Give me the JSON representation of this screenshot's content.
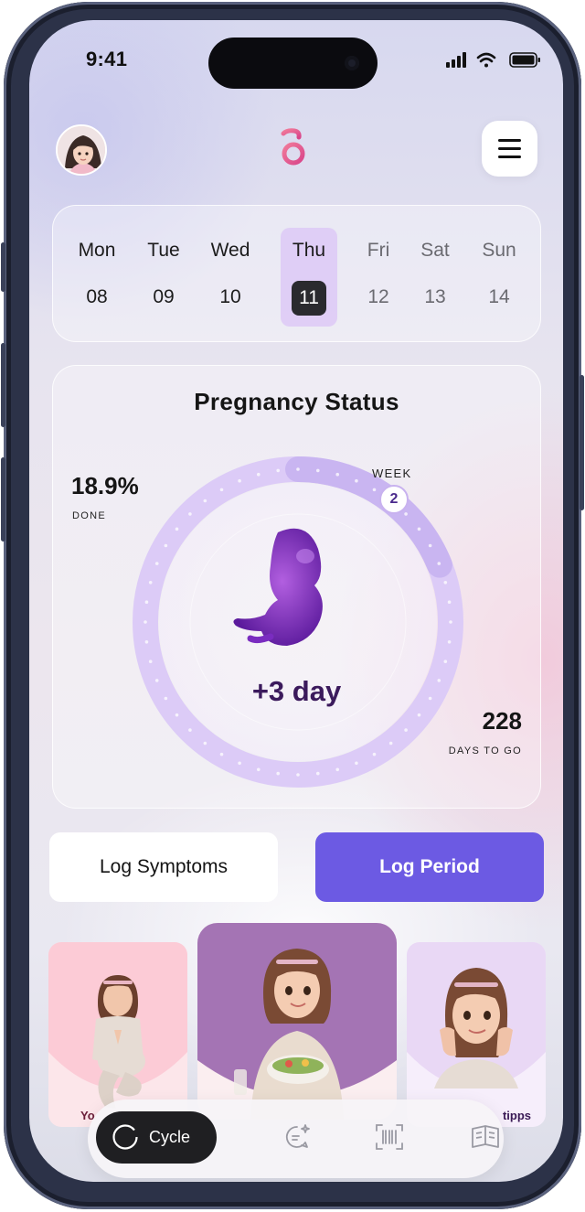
{
  "status_bar": {
    "time": "9:41"
  },
  "header": {
    "menu_icon": "hamburger-menu-icon",
    "brand_color": "#e15a8e"
  },
  "calendar": {
    "days": [
      {
        "name": "Mon",
        "num": "08"
      },
      {
        "name": "Tue",
        "num": "09"
      },
      {
        "name": "Wed",
        "num": "10"
      },
      {
        "name": "Thu",
        "num": "11"
      },
      {
        "name": "Fri",
        "num": "12"
      },
      {
        "name": "Sat",
        "num": "13"
      },
      {
        "name": "Sun",
        "num": "14"
      }
    ],
    "selected": "Thu"
  },
  "pregnancy": {
    "title": "Pregnancy Status",
    "percent_done": "18.9%",
    "done_label": "DONE",
    "week_label": "WEEK",
    "week_value": "2",
    "day_delta": "+3 day",
    "days_to_go": "228",
    "days_to_go_label": "DAYS TO GO",
    "progress": 0.189,
    "ring_color": "#c9b5f1"
  },
  "actions": {
    "log_symptoms": "Log Symptoms",
    "log_period": "Log Period",
    "accent": "#6c5ae3"
  },
  "tiles": [
    {
      "label": "Yo"
    },
    {
      "label": ""
    },
    {
      "label": "tipps"
    }
  ],
  "bottom_nav": {
    "active_label": "Cycle",
    "items": [
      "cycle-icon",
      "chat-sparkle-icon",
      "barcode-scan-icon",
      "book-icon"
    ]
  }
}
